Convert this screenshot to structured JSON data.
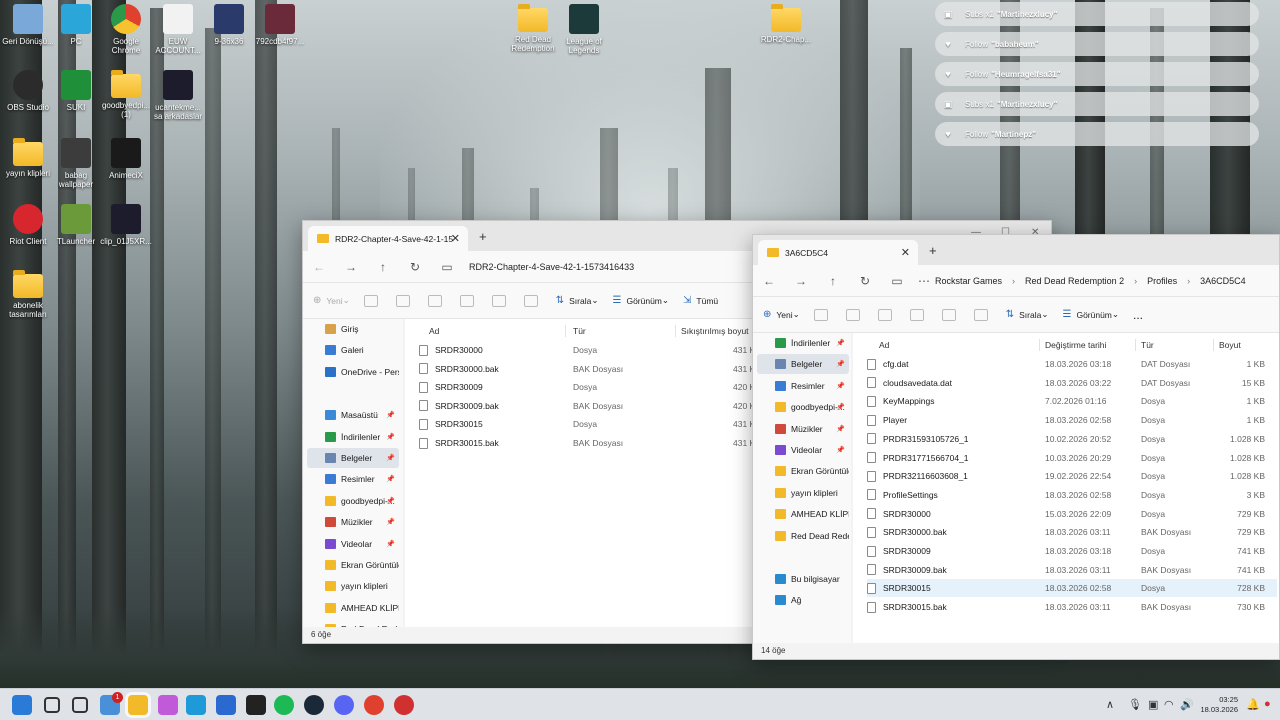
{
  "desktop": {
    "icons": [
      {
        "label": "Geri Dönüşü...",
        "icon": "recycle-bin-icon",
        "color": "#7aa8d8"
      },
      {
        "label": "PC",
        "icon": "monitor-icon",
        "color": "#2aa7d8"
      },
      {
        "label": "Google Chrome",
        "icon": "chrome-icon",
        "color": "#e0412f"
      },
      {
        "label": "EUW ACCOUNT...",
        "icon": "text-file-icon",
        "color": "#f2f2f2"
      },
      {
        "label": "9-36x36",
        "icon": "image-icon",
        "color": "#2a3a6a"
      },
      {
        "label": "792cdb4f97...",
        "icon": "image-icon",
        "color": "#6a2a3a"
      },
      {
        "label": "Red Dead Redemption",
        "icon": "folder-icon",
        "color": "#f2b928"
      },
      {
        "label": "League of Legends",
        "icon": "league-of-legends-icon",
        "color": "#1d3a3a"
      },
      {
        "label": "RDR2-Chap...",
        "icon": "folder-icon",
        "color": "#f2b928"
      },
      {
        "label": "OBS Studio",
        "icon": "obs-icon",
        "color": "#2b2b2b"
      },
      {
        "label": "SUKI",
        "icon": "suki-icon",
        "color": "#1f8f3a"
      },
      {
        "label": "goodbyedpi... (1)",
        "icon": "folder-icon",
        "color": "#f2b928"
      },
      {
        "label": "ucantekme... sa arkadaslar",
        "icon": "video-icon",
        "color": "#1c1c2c"
      },
      {
        "label": "yayın klipleri",
        "icon": "folder-icon",
        "color": "#f2b928"
      },
      {
        "label": "babag wallpaper",
        "icon": "image-icon",
        "color": "#3c3c3c"
      },
      {
        "label": "AnimeciX",
        "icon": "animecix-icon",
        "color": "#1a1a1a"
      },
      {
        "label": "Riot Client",
        "icon": "riot-client-icon",
        "color": "#d7262e"
      },
      {
        "label": "TLauncher",
        "icon": "minecraft-icon",
        "color": "#6b9a3a"
      },
      {
        "label": "clip_01J5XR...",
        "icon": "video-icon",
        "color": "#1c1c2c"
      },
      {
        "label": "abonelik tasarımları",
        "icon": "folder-icon",
        "color": "#f2b928"
      }
    ]
  },
  "notifications": [
    {
      "icon": "gift-icon",
      "prefix": "Subs x1",
      "name": "\"Martinezxlucy\""
    },
    {
      "icon": "heart-icon",
      "prefix": "Follow",
      "name": "\"babaheum\""
    },
    {
      "icon": "heart-icon",
      "prefix": "Follow",
      "name": "\"Heumragelfsa31\""
    },
    {
      "icon": "gift-icon",
      "prefix": "Subs x1",
      "name": "\"Martinezxlucy\""
    },
    {
      "icon": "heart-icon",
      "prefix": "Follow",
      "name": "\"Martinepz\""
    }
  ],
  "left_window": {
    "tab_title": "RDR2-Chapter-4-Save-42-1-15",
    "address": "RDR2-Chapter-4-Save-42-1-1573416433",
    "toolbar": {
      "new_label": "Yeni",
      "sort_label": "Sırala",
      "view_label": "Görünüm",
      "all_label": "Tümü"
    },
    "sidebar": [
      {
        "label": "Giriş",
        "color": "#d8a24a"
      },
      {
        "label": "Galeri",
        "color": "#3a7bd5"
      },
      {
        "label": "OneDrive - Perso",
        "color": "#2a72c8"
      },
      {
        "label": "Masaüstü",
        "color": "#3a8ad8"
      },
      {
        "label": "İndirilenler",
        "color": "#2a9a4a"
      },
      {
        "label": "Belgeler",
        "color": "#6a86b0"
      },
      {
        "label": "Resimler",
        "color": "#3a7bd5"
      },
      {
        "label": "goodbyedpi-...",
        "color": "#f2b928"
      },
      {
        "label": "Müzikler",
        "color": "#d04a3a"
      },
      {
        "label": "Videolar",
        "color": "#7a4ad0"
      },
      {
        "label": "Ekran Görüntüle",
        "color": "#f2b928"
      },
      {
        "label": "yayın klipleri",
        "color": "#f2b928"
      },
      {
        "label": "AMHEAD KLİPLE",
        "color": "#f2b928"
      },
      {
        "label": "Red Dead Reder",
        "color": "#f2b928"
      }
    ],
    "columns": {
      "name": "Ad",
      "type": "Tür",
      "size": "Sıkıştırılmış boyut"
    },
    "files": [
      {
        "name": "SRDR30000",
        "type": "Dosya",
        "size": "431 KB"
      },
      {
        "name": "SRDR30000.bak",
        "type": "BAK Dosyası",
        "size": "431 KB"
      },
      {
        "name": "SRDR30009",
        "type": "Dosya",
        "size": "420 KB"
      },
      {
        "name": "SRDR30009.bak",
        "type": "BAK Dosyası",
        "size": "420 KB"
      },
      {
        "name": "SRDR30015",
        "type": "Dosya",
        "size": "431 KB"
      },
      {
        "name": "SRDR30015.bak",
        "type": "BAK Dosyası",
        "size": "431 KB"
      }
    ],
    "status": "6 öğe"
  },
  "right_window": {
    "tab_title": "3A6CD5C4",
    "breadcrumb": [
      "Rockstar Games",
      "Red Dead Redemption 2",
      "Profiles",
      "3A6CD5C4"
    ],
    "toolbar": {
      "new_label": "Yeni",
      "sort_label": "Sırala",
      "view_label": "Görünüm",
      "more_label": "..."
    },
    "sidebar": [
      {
        "label": "İndirilenler",
        "color": "#2a9a4a"
      },
      {
        "label": "Belgeler",
        "color": "#6a86b0"
      },
      {
        "label": "Resimler",
        "color": "#3a7bd5"
      },
      {
        "label": "goodbyedpi-...",
        "color": "#f2b928"
      },
      {
        "label": "Müzikler",
        "color": "#d04a3a"
      },
      {
        "label": "Videolar",
        "color": "#7a4ad0"
      },
      {
        "label": "Ekran Görüntüle",
        "color": "#f2b928"
      },
      {
        "label": "yayın klipleri",
        "color": "#f2b928"
      },
      {
        "label": "AMHEAD KLİPLE",
        "color": "#f2b928"
      },
      {
        "label": "Red Dead Reder",
        "color": "#f2b928"
      },
      {
        "label": "Bu bilgisayar",
        "color": "#2a8ad0"
      },
      {
        "label": "Ağ",
        "color": "#2a8ad0"
      }
    ],
    "columns": {
      "name": "Ad",
      "modified": "Değiştirme tarihi",
      "type": "Tür",
      "size": "Boyut"
    },
    "files": [
      {
        "name": "cfg.dat",
        "modified": "18.03.2026 03:18",
        "type": "DAT Dosyası",
        "size": "1 KB"
      },
      {
        "name": "cloudsavedata.dat",
        "modified": "18.03.2026 03:22",
        "type": "DAT Dosyası",
        "size": "15 KB"
      },
      {
        "name": "KeyMappings",
        "modified": "7.02.2026 01:16",
        "type": "Dosya",
        "size": "1 KB"
      },
      {
        "name": "Player",
        "modified": "18.03.2026 02:58",
        "type": "Dosya",
        "size": "1 KB"
      },
      {
        "name": "PRDR31593105726_1",
        "modified": "10.02.2026 20:52",
        "type": "Dosya",
        "size": "1.028 KB"
      },
      {
        "name": "PRDR31771566704_1",
        "modified": "10.03.2026 20:29",
        "type": "Dosya",
        "size": "1.028 KB"
      },
      {
        "name": "PRDR32116603608_1",
        "modified": "19.02.2026 22:54",
        "type": "Dosya",
        "size": "1.028 KB"
      },
      {
        "name": "ProfileSettings",
        "modified": "18.03.2026 02:58",
        "type": "Dosya",
        "size": "3 KB"
      },
      {
        "name": "SRDR30000",
        "modified": "15.03.2026 22:09",
        "type": "Dosya",
        "size": "729 KB"
      },
      {
        "name": "SRDR30000.bak",
        "modified": "18.03.2026 03:11",
        "type": "BAK Dosyası",
        "size": "729 KB"
      },
      {
        "name": "SRDR30009",
        "modified": "18.03.2026 03:18",
        "type": "Dosya",
        "size": "741 KB"
      },
      {
        "name": "SRDR30009.bak",
        "modified": "18.03.2026 03:11",
        "type": "BAK Dosyası",
        "size": "741 KB"
      },
      {
        "name": "SRDR30015",
        "modified": "18.03.2026 02:58",
        "type": "Dosya",
        "size": "728 KB"
      },
      {
        "name": "SRDR30015.bak",
        "modified": "18.03.2026 03:11",
        "type": "BAK Dosyası",
        "size": "730 KB"
      }
    ],
    "highlighted_row": 12,
    "status": "14 öğe"
  },
  "taskbar": {
    "apps": [
      {
        "name": "start-icon",
        "color": "#2a7ad8"
      },
      {
        "name": "search-icon",
        "color": "#333333"
      },
      {
        "name": "task-view-icon",
        "color": "#333333"
      },
      {
        "name": "widgets-icon",
        "color": "#4a90d8"
      },
      {
        "name": "file-explorer-icon",
        "color": "#f2b928"
      },
      {
        "name": "copilot-icon",
        "color": "#c05ad8"
      },
      {
        "name": "edge-icon",
        "color": "#1f9ad8"
      },
      {
        "name": "store-icon",
        "color": "#2a6ad0"
      },
      {
        "name": "epic-games-icon",
        "color": "#222222"
      },
      {
        "name": "spotify-icon",
        "color": "#1db954"
      },
      {
        "name": "steam-icon",
        "color": "#1b2838"
      },
      {
        "name": "discord-icon",
        "color": "#5865f2"
      },
      {
        "name": "chrome-icon",
        "color": "#e0412f"
      },
      {
        "name": "rockstar-icon",
        "color": "#d03030"
      }
    ],
    "widgets_badge": "1",
    "time": "03:25",
    "date": "18.03.2026"
  }
}
